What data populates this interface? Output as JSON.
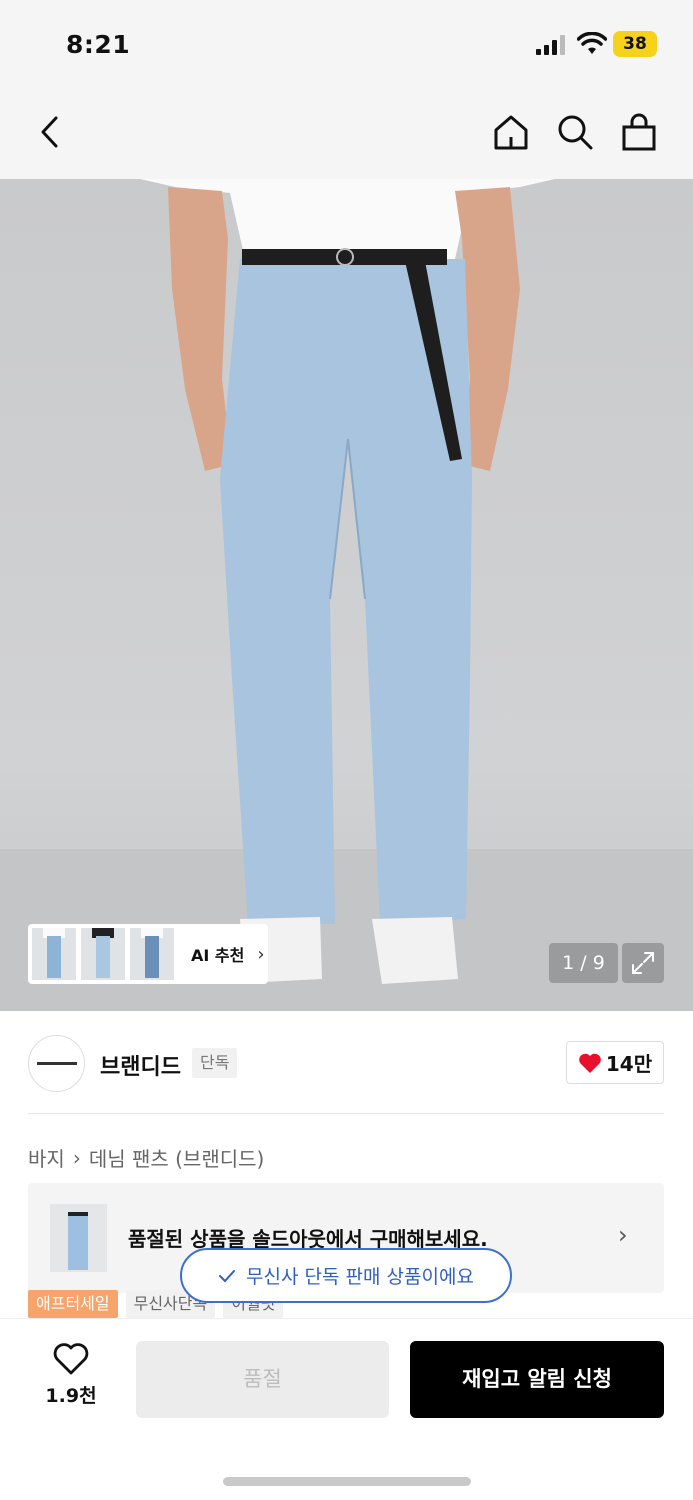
{
  "status_bar": {
    "time": "8:21",
    "battery": "38"
  },
  "gallery": {
    "ai_label": "AI 추천",
    "page_indicator": "1 / 9"
  },
  "brand": {
    "name": "브랜디드",
    "exclusive_tag": "단독",
    "likes": "14만"
  },
  "breadcrumb": {
    "category": "바지",
    "sub": "데님 팬츠 (브랜디드)"
  },
  "banner": {
    "text": "품절된 상품을 솔드아웃에서 구매해보세요."
  },
  "toast": {
    "text": "무신사 단독 판매 상품이에요"
  },
  "tags": [
    "애프터세일",
    "무신사단독",
    "이월핏"
  ],
  "bottom": {
    "wish_count": "1.9천",
    "soldout_label": "품절",
    "restock_label": "재입고 알림 신청"
  },
  "colors": {
    "accent_blue": "#3b6fd1",
    "heart_red": "#e8112d",
    "tag_orange": "#f7a46c"
  }
}
